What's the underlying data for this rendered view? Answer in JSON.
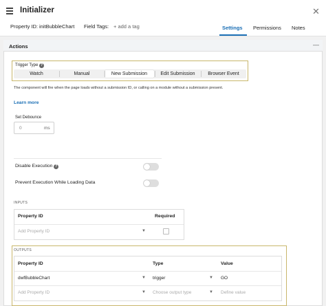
{
  "header": {
    "title": "Initializer",
    "property_id_label": "Property ID:",
    "property_id_value": "initBubbleChart",
    "field_tags_label": "Field Tags:",
    "add_tag": "+ add a tag",
    "close": "✕",
    "tabs": [
      {
        "label": "Settings",
        "active": true
      },
      {
        "label": "Permissions",
        "active": false
      },
      {
        "label": "Notes",
        "active": false
      }
    ]
  },
  "actions": {
    "title": "Actions",
    "trigger": {
      "label": "Trigger Type",
      "options": [
        "Watch",
        "Manual",
        "New Submission",
        "Edit Submission",
        "Browser Event"
      ],
      "selected": "New Submission"
    },
    "description": "The component will fire when the page loads without a submission ID, or calling on a module without a submission present.",
    "learn_more": "Learn more",
    "debounce": {
      "label": "Set Debounce",
      "value": "0",
      "unit": "ms"
    },
    "disable_execution": {
      "label": "Disable Execution",
      "on": false
    },
    "prevent_execution": {
      "label": "Prevent Execution While Loading Data",
      "on": false
    }
  },
  "inputs": {
    "section_label": "INPUTS",
    "columns": [
      "Property ID",
      "Required"
    ],
    "placeholder": "Add Property ID"
  },
  "outputs": {
    "section_label": "OUTPUTS",
    "columns": [
      "Property ID",
      "Type",
      "Value"
    ],
    "rows": [
      {
        "property_id": "dwfBubbleChart",
        "type": "trigger",
        "value": "GO"
      }
    ],
    "new_row": {
      "property_id": "Add Property ID",
      "type": "Choose output type",
      "value": "Define value"
    }
  },
  "colors": {
    "accent": "#1b6fb5",
    "highlight_border": "#c8b66a"
  }
}
